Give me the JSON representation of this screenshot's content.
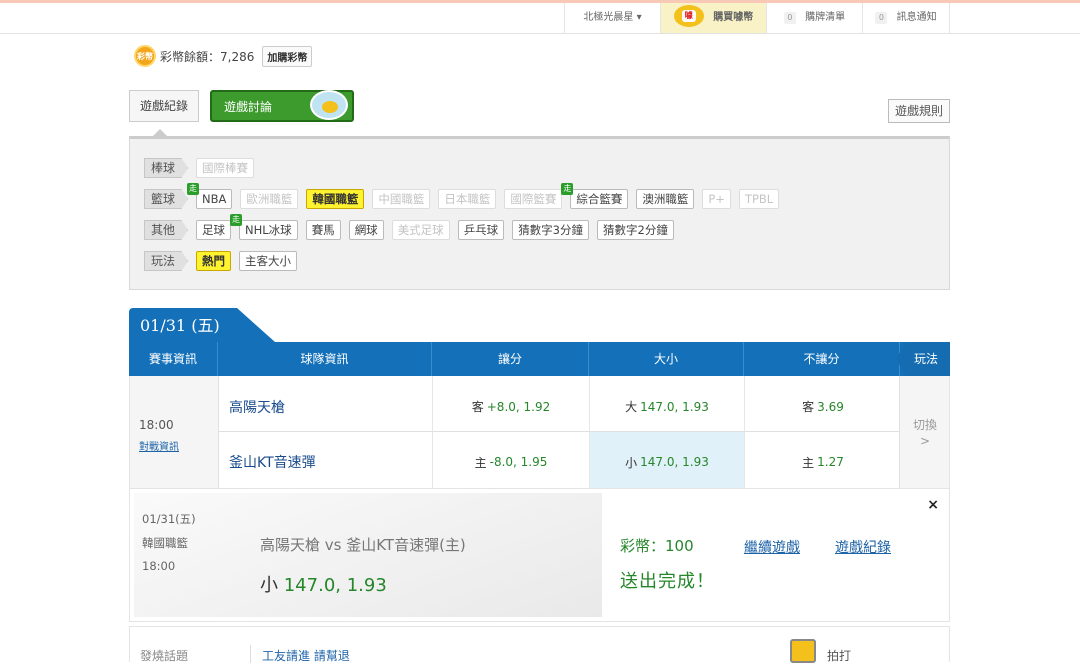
{
  "topbar": {
    "star_label": "北極光晨星 ▾",
    "buy_label": "購買噱幣",
    "buy_badge": "噱",
    "cart_count": "0",
    "cart_label": "購牌清單",
    "msg_count": "0",
    "msg_label": "訊息通知"
  },
  "coins": {
    "icon_text": "彩幣",
    "label": "彩幣餘額：7,286",
    "buy_button": "加購彩幣"
  },
  "tabs": {
    "record": "遊戲紀錄",
    "discuss": "遊戲討論",
    "rules": "遊戲規則"
  },
  "filter": {
    "rows": [
      {
        "category": "棒球",
        "items": [
          {
            "label": "國際棒賽",
            "state": "disabled"
          }
        ]
      },
      {
        "category": "籃球",
        "items": [
          {
            "label": "NBA",
            "state": "normal",
            "new": "走"
          },
          {
            "label": "歐洲職籃",
            "state": "disabled"
          },
          {
            "label": "韓國職籃",
            "state": "active"
          },
          {
            "label": "中國職籃",
            "state": "disabled"
          },
          {
            "label": "日本職籃",
            "state": "disabled"
          },
          {
            "label": "國際籃賽",
            "state": "disabled"
          },
          {
            "label": "綜合籃賽",
            "state": "normal",
            "new": "走"
          },
          {
            "label": "澳洲職籃",
            "state": "normal"
          },
          {
            "label": "P+",
            "state": "disabled"
          },
          {
            "label": "TPBL",
            "state": "disabled"
          }
        ]
      },
      {
        "category": "其他",
        "items": [
          {
            "label": "足球",
            "state": "normal"
          },
          {
            "label": "NHL冰球",
            "state": "normal",
            "new": "走"
          },
          {
            "label": "賽馬",
            "state": "normal"
          },
          {
            "label": "網球",
            "state": "normal"
          },
          {
            "label": "美式足球",
            "state": "disabled"
          },
          {
            "label": "乒乓球",
            "state": "normal"
          },
          {
            "label": "猜數字3分鐘",
            "state": "normal"
          },
          {
            "label": "猜數字2分鐘",
            "state": "normal"
          }
        ]
      },
      {
        "category": "玩法",
        "items": [
          {
            "label": "熱門",
            "state": "active"
          },
          {
            "label": "主客大小",
            "state": "normal"
          }
        ]
      }
    ]
  },
  "date_tab": "01/31 (五)",
  "table": {
    "headers": [
      "賽事資訊",
      "球隊資訊",
      "讓分",
      "大小",
      "不讓分",
      "玩法"
    ],
    "time": "18:00",
    "match_link": "對戰資訊",
    "rows": [
      {
        "team": "高陽天槍",
        "spread_label": "客",
        "spread_val": "+8.0, 1.92",
        "total_label": "大",
        "total_val": "147.0, 1.93",
        "ml_label": "客",
        "ml_val": "3.69"
      },
      {
        "team": "釜山KT音速彈",
        "spread_label": "主",
        "spread_val": "-8.0, 1.95",
        "total_label": "小",
        "total_val": "147.0, 1.93",
        "ml_label": "主",
        "ml_val": "1.27"
      }
    ],
    "switch_label": "切換",
    "switch_arrow": ">"
  },
  "confirm": {
    "date": "01/31(五)",
    "league": "韓國職籃",
    "time": "18:00",
    "matchup": "高陽天槍  vs  釜山KT音速彈(主)",
    "pick_label": "小",
    "pick_value": "147.0, 1.93",
    "coins": "彩幣：100",
    "done": "送出完成！",
    "continue_link": "繼續遊戲",
    "record_link": "遊戲紀錄",
    "close": "×"
  },
  "bottom": {
    "hot": "發燒話題",
    "topic": "工友請進 請幫退",
    "clap": "拍打"
  }
}
